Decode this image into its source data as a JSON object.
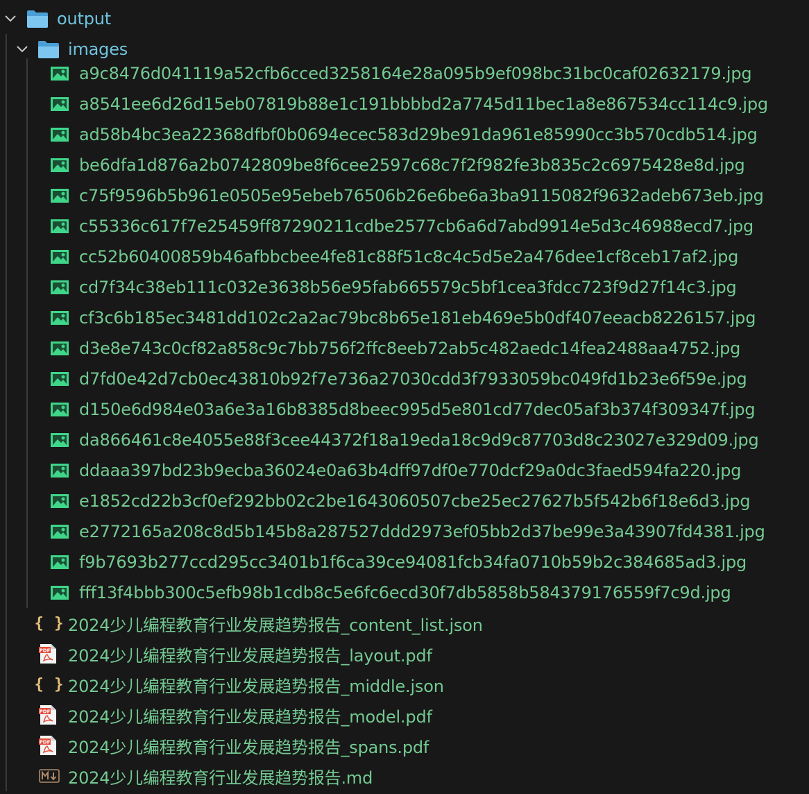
{
  "explorer": {
    "folders": [
      {
        "name": "output",
        "icon": "folder-icon",
        "chevron": "chevron-down-icon",
        "expanded": true
      },
      {
        "name": "images",
        "icon": "folder-icon",
        "chevron": "chevron-down-icon",
        "expanded": true
      }
    ],
    "image_files": [
      "a9c8476d041119a52cfb6cced3258164e28a095b9ef098bc31bc0caf02632179.jpg",
      "a8541ee6d26d15eb07819b88e1c191bbbbd2a7745d11bec1a8e867534cc114c9.jpg",
      "ad58b4bc3ea22368dfbf0b0694ecec583d29be91da961e85990cc3b570cdb514.jpg",
      "be6dfa1d876a2b0742809be8f6cee2597c68c7f2f982fe3b835c2c6975428e8d.jpg",
      "c75f9596b5b961e0505e95ebeb76506b26e6be6a3ba9115082f9632adeb673eb.jpg",
      "c55336c617f7e25459ff87290211cdbe2577cb6a6d7abd9914e5d3c46988ecd7.jpg",
      "cc52b60400859b46afbbcbee4fe81c88f51c8c4c5d5e2a476dee1cf8ceb17af2.jpg",
      "cd7f34c38eb111c032e3638b56e95fab665579c5bf1cea3fdcc723f9d27f14c3.jpg",
      "cf3c6b185ec3481dd102c2a2ac79bc8b65e181eb469e5b0df407eeacb8226157.jpg",
      "d3e8e743c0cf82a858c9c7bb756f2ffc8eeb72ab5c482aedc14fea2488aa4752.jpg",
      "d7fd0e42d7cb0ec43810b92f7e736a27030cdd3f7933059bc049fd1b23e6f59e.jpg",
      "d150e6d984e03a6e3a16b8385d8beec995d5e801cd77dec05af3b374f309347f.jpg",
      "da866461c8e4055e88f3cee44372f18a19eda18c9d9c87703d8c23027e329d09.jpg",
      "ddaaa397bd23b9ecba36024e0a63b4dff97df0e770dcf29a0dc3faed594fa220.jpg",
      "e1852cd22b3cf0ef292bb02c2be1643060507cbe25ec27627b5f542b6f18e6d3.jpg",
      "e2772165a208c8d5b145b8a287527ddd2973ef05bb2d37be99e3a43907fd4381.jpg",
      "f9b7693b277ccd295cc3401b1f6ca39ce94081fcb34fa0710b59b2c384685ad3.jpg",
      "fff13f4bbb300c5efb98b1cdb8c5e6fc6ecd30f7db5858b584379176559f7c9d.jpg"
    ],
    "image_file_icon": "image-file-icon",
    "output_files": [
      {
        "name": "2024少儿编程教育行业发展趋势报告_content_list.json",
        "icon": "json-file-icon",
        "icon_text": "{ }"
      },
      {
        "name": "2024少儿编程教育行业发展趋势报告_layout.pdf",
        "icon": "pdf-file-icon",
        "icon_text": "PDF"
      },
      {
        "name": "2024少儿编程教育行业发展趋势报告_middle.json",
        "icon": "json-file-icon",
        "icon_text": "{ }"
      },
      {
        "name": "2024少儿编程教育行业发展趋势报告_model.pdf",
        "icon": "pdf-file-icon",
        "icon_text": "PDF"
      },
      {
        "name": "2024少儿编程教育行业发展趋势报告_spans.pdf",
        "icon": "pdf-file-icon",
        "icon_text": "PDF"
      },
      {
        "name": "2024少儿编程教育行业发展趋势报告.md",
        "icon": "markdown-file-icon",
        "icon_text": "M↓"
      }
    ]
  },
  "colors": {
    "background": "#181818",
    "folder_text": "#6fc3df",
    "file_text": "#73c991",
    "image_icon": "#3fd68a",
    "json_icon": "#e5c07b",
    "pdf_icon": "#e34b3a",
    "md_icon": "#b08a6a",
    "folder_icon": "#7cc6f0"
  }
}
